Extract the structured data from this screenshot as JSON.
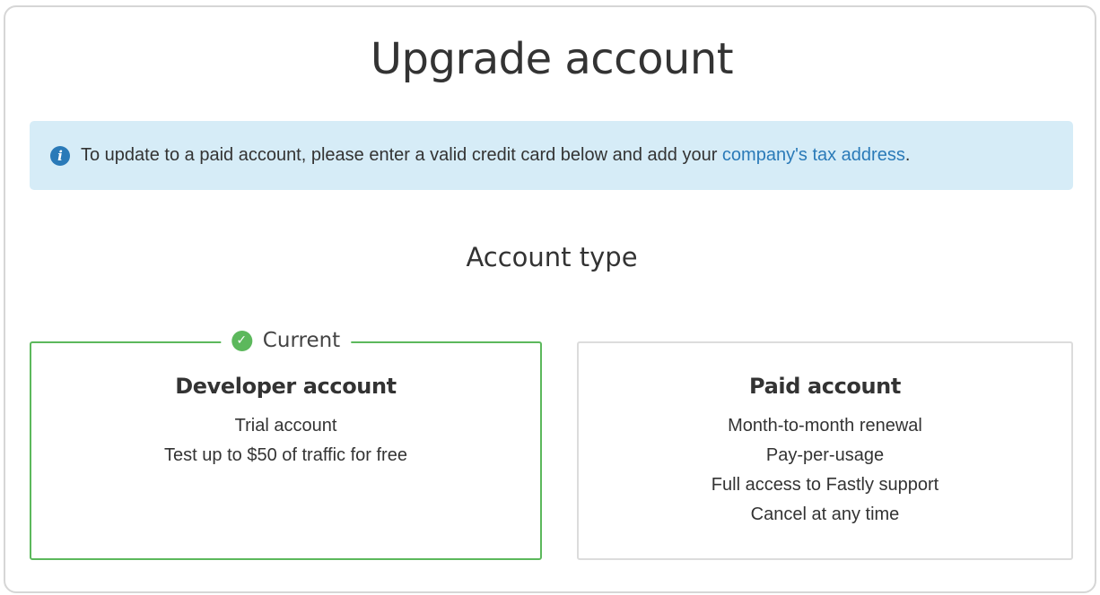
{
  "header": {
    "title": "Upgrade account"
  },
  "notice": {
    "icon": "info-icon",
    "icon_glyph": "i",
    "text_before": "To update to a paid account, please enter a valid credit card below and add your ",
    "link_text": "company's tax address",
    "text_after": "."
  },
  "account_type": {
    "heading": "Account type",
    "cards": [
      {
        "badge_label": "Current",
        "badge_icon": "check-circle-icon",
        "title": "Developer account",
        "features": [
          "Trial account",
          "Test up to $50 of traffic for free"
        ]
      },
      {
        "title": "Paid account",
        "features": [
          "Month-to-month renewal",
          "Pay-per-usage",
          "Full access to Fastly support",
          "Cancel at any time"
        ]
      }
    ]
  },
  "colors": {
    "accent_blue": "#2a7ab8",
    "notice_bg": "#d6ecf7",
    "success_green": "#5cb85c",
    "card_border": "#dcdcdc"
  }
}
